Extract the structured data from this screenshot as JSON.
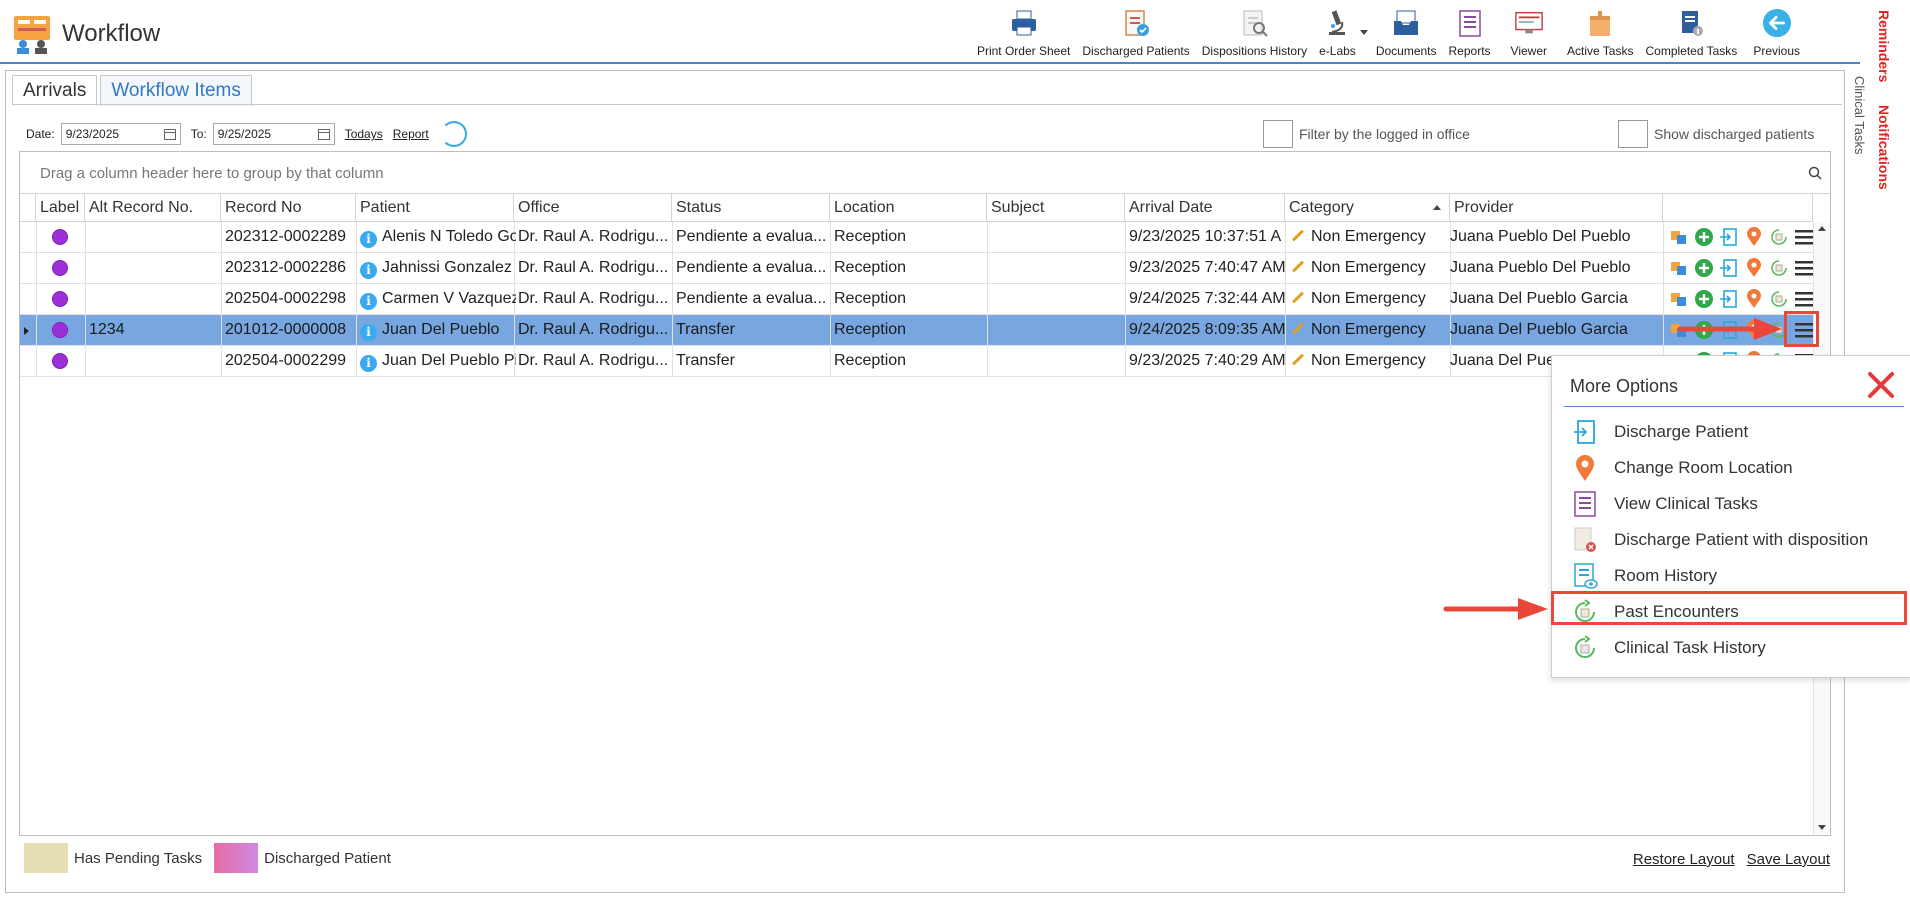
{
  "app": {
    "title": "Workflow"
  },
  "toolbar": [
    {
      "label": "Print Order Sheet",
      "icon": "printer-icon"
    },
    {
      "label": "Discharged Patients",
      "icon": "clipboard-check-icon"
    },
    {
      "label": "Dispositions History",
      "icon": "document-search-icon"
    },
    {
      "label": "e-Labs",
      "icon": "microscope-icon"
    },
    {
      "label": "Documents",
      "icon": "inbox-icon"
    },
    {
      "label": "Reports",
      "icon": "report-icon"
    },
    {
      "label": "Viewer",
      "icon": "monitor-icon"
    },
    {
      "label": "Active Tasks",
      "icon": "box-icon"
    },
    {
      "label": "Completed Tasks",
      "icon": "document-info-icon"
    },
    {
      "label": "Previous",
      "icon": "back-arrow-icon"
    }
  ],
  "rail": {
    "reminders": "Reminders",
    "notifications": "Notifications",
    "clinical_tasks": "Clinical Tasks"
  },
  "tabs": {
    "arrivals": "Arrivals",
    "workflow_items": "Workflow Items"
  },
  "filters": {
    "date_label": "Date:",
    "date_from": "9/23/2025",
    "to_label": "To:",
    "date_to": "9/25/2025",
    "todays": "Todays",
    "report": "Report",
    "filter_office": "Filter by the logged in office",
    "show_discharged": "Show discharged patients"
  },
  "grid": {
    "group_hint": "Drag a column header here to group by that column",
    "columns": [
      "Label",
      "Alt Record No.",
      "Record No",
      "Patient",
      "Office",
      "Status",
      "Location",
      "Subject",
      "Arrival Date",
      "Category",
      "Provider"
    ],
    "rows": [
      {
        "alt": "",
        "record": "202312-0002289",
        "patient": "Alenis N Toledo Go",
        "office": "Dr. Raul A. Rodrigu...",
        "status": "Pendiente a evalua...",
        "location": "Reception",
        "subject": "",
        "arrival": "9/23/2025 10:37:51 A",
        "category": "Non Emergency",
        "provider": "Juana Pueblo Del Pueblo"
      },
      {
        "alt": "",
        "record": "202312-0002286",
        "patient": "Jahnissi Gonzalez C",
        "office": "Dr. Raul A. Rodrigu...",
        "status": "Pendiente a evalua...",
        "location": "Reception",
        "subject": "",
        "arrival": "9/23/2025 7:40:47 AM",
        "category": "Non Emergency",
        "provider": "Juana Pueblo Del Pueblo"
      },
      {
        "alt": "",
        "record": "202504-0002298",
        "patient": "Carmen V Vazquez",
        "office": "Dr. Raul A. Rodrigu...",
        "status": "Pendiente a evalua...",
        "location": "Reception",
        "subject": "",
        "arrival": "9/24/2025 7:32:44 AM",
        "category": "Non Emergency",
        "provider": "Juana Del Pueblo Garcia"
      },
      {
        "alt": "1234",
        "record": "201012-0000008",
        "patient": "Juan Del Pueblo",
        "office": "Dr. Raul A. Rodrigu...",
        "status": "Transfer",
        "location": "Reception",
        "subject": "",
        "arrival": "9/24/2025 8:09:35 AM",
        "category": "Non Emergency",
        "provider": "Juana Del Pueblo Garcia"
      },
      {
        "alt": "",
        "record": "202504-0002299",
        "patient": "Juan Del Pueblo Pi",
        "office": "Dr. Raul A. Rodrigu...",
        "status": "Transfer",
        "location": "Reception",
        "subject": "",
        "arrival": "9/23/2025 7:40:29 AM",
        "category": "Non Emergency",
        "provider": "Juana Del Pue"
      }
    ]
  },
  "legend": {
    "pending": "Has Pending Tasks",
    "discharged": "Discharged Patient",
    "pending_color": "#e6dfb4",
    "discharged_color": "#e86aa8"
  },
  "footer": {
    "restore": "Restore Layout",
    "save": "Save Layout"
  },
  "popup": {
    "title": "More Options",
    "items": [
      {
        "label": "Discharge Patient",
        "icon": "discharge-icon"
      },
      {
        "label": "Change Room Location",
        "icon": "location-pin-icon"
      },
      {
        "label": "View Clinical Tasks",
        "icon": "task-list-icon"
      },
      {
        "label": "Discharge Patient with disposition",
        "icon": "document-x-icon"
      },
      {
        "label": "Room History",
        "icon": "room-history-icon"
      },
      {
        "label": "Past Encounters",
        "icon": "past-encounters-icon"
      },
      {
        "label": "Clinical Task History",
        "icon": "task-history-icon"
      }
    ]
  },
  "colors": {
    "accent": "#4a86c5",
    "selected_row": "#77a6e0",
    "highlight": "#e8473a",
    "label_dot": "#9b30d8"
  }
}
